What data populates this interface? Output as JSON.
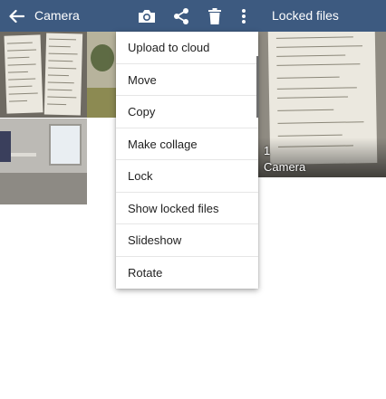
{
  "appbar": {
    "title": "Camera",
    "locked_title": "Locked files",
    "background": "#3d5a80",
    "icons": [
      "back-arrow-icon",
      "camera-icon",
      "share-icon",
      "delete-icon",
      "more-vert-icon"
    ]
  },
  "menu": {
    "items": [
      {
        "label": "Upload to cloud"
      },
      {
        "label": "Move"
      },
      {
        "label": "Copy"
      },
      {
        "label": "Make collage"
      },
      {
        "label": "Lock"
      },
      {
        "label": "Show locked files"
      },
      {
        "label": "Slideshow"
      },
      {
        "label": "Rotate"
      }
    ]
  },
  "folder": {
    "count": "1",
    "name": "Camera"
  }
}
